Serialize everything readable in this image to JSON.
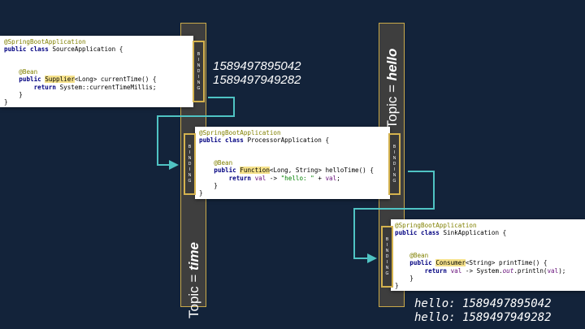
{
  "topics": {
    "time": {
      "prefix": "Topic = ",
      "name": "time"
    },
    "hello": {
      "prefix": "Topic = ",
      "name": "hello"
    }
  },
  "binding_letters": [
    "B",
    "I",
    "N",
    "D",
    "I",
    "N",
    "G"
  ],
  "source": {
    "annotation": "@SpringBootApplication",
    "kw_public": "public",
    "kw_class": "class",
    "class_name": " SourceApplication {",
    "bean": "@Bean",
    "type": "Supplier",
    "signature": "<Long> currentTime() {",
    "kw_return": "return",
    "body": " System::currentTimeMillis;",
    "close_method": "}",
    "close_class": "}"
  },
  "processor": {
    "annotation": "@SpringBootApplication",
    "kw_public": "public",
    "kw_class": "class",
    "class_name": " ProcessorApplication {",
    "bean": "@Bean",
    "type": "Function",
    "signature": "<Long, String> helloTime() {",
    "kw_return": "return",
    "param": "val",
    "arrow": " -> ",
    "string": "\"hello: \"",
    "plus": " + ",
    "param2": "val",
    "semi": ";",
    "close_method": "}",
    "close_class": "}"
  },
  "sink": {
    "annotation": "@SpringBootApplication",
    "kw_public": "public",
    "kw_class": "class",
    "class_name": " SinkApplication {",
    "bean": "@Bean",
    "type": "Consumer",
    "signature": "<String> printTime() {",
    "kw_return": "return",
    "param": "val",
    "mid": " -> System.",
    "out": "out",
    "tail": ".println(",
    "param2": "val",
    "end": ");",
    "close_method": "}",
    "close_class": "}"
  },
  "timestamps": [
    "1589497895042",
    "1589497949282"
  ],
  "outputs": [
    "hello: 1589497895042",
    "hello: 1589497949282"
  ],
  "colors": {
    "background": "#13233a",
    "arrow": "#4fc3c3",
    "border": "#d4b24e"
  }
}
